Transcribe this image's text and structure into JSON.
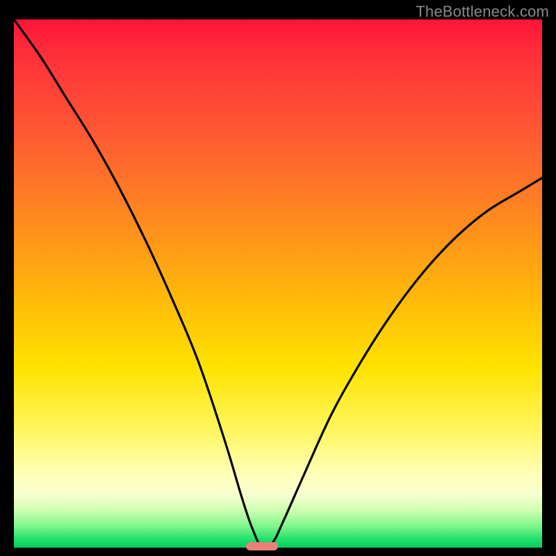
{
  "watermark": "TheBottleneck.com",
  "colors": {
    "marker": "#e98079",
    "curve_stroke": "#000000",
    "background_black": "#000000"
  },
  "chart_data": {
    "type": "line",
    "title": "",
    "xlabel": "",
    "ylabel": "",
    "xlim": [
      0,
      100
    ],
    "ylim": [
      0,
      100
    ],
    "grid": false,
    "legend": false,
    "note": "No axis ticks or numeric labels are shown; x/y in abstract 0-100 units. Curve height ≈ bottleneck %, color gradient encodes same scale (green≈0 → red≈100). Minimum near x≈47.",
    "series": [
      {
        "name": "bottleneck-curve",
        "x": [
          0,
          5,
          10,
          15,
          20,
          25,
          30,
          35,
          40,
          43,
          45,
          47,
          49,
          51,
          55,
          60,
          65,
          70,
          75,
          80,
          85,
          90,
          95,
          100
        ],
        "values": [
          100,
          93,
          85,
          77,
          68,
          58,
          47,
          35,
          20,
          10,
          4,
          0,
          1,
          5,
          14,
          25,
          34,
          42,
          49,
          55,
          60,
          64,
          67,
          70
        ]
      }
    ],
    "marker": {
      "x": 47,
      "y": 0,
      "label": ""
    }
  }
}
